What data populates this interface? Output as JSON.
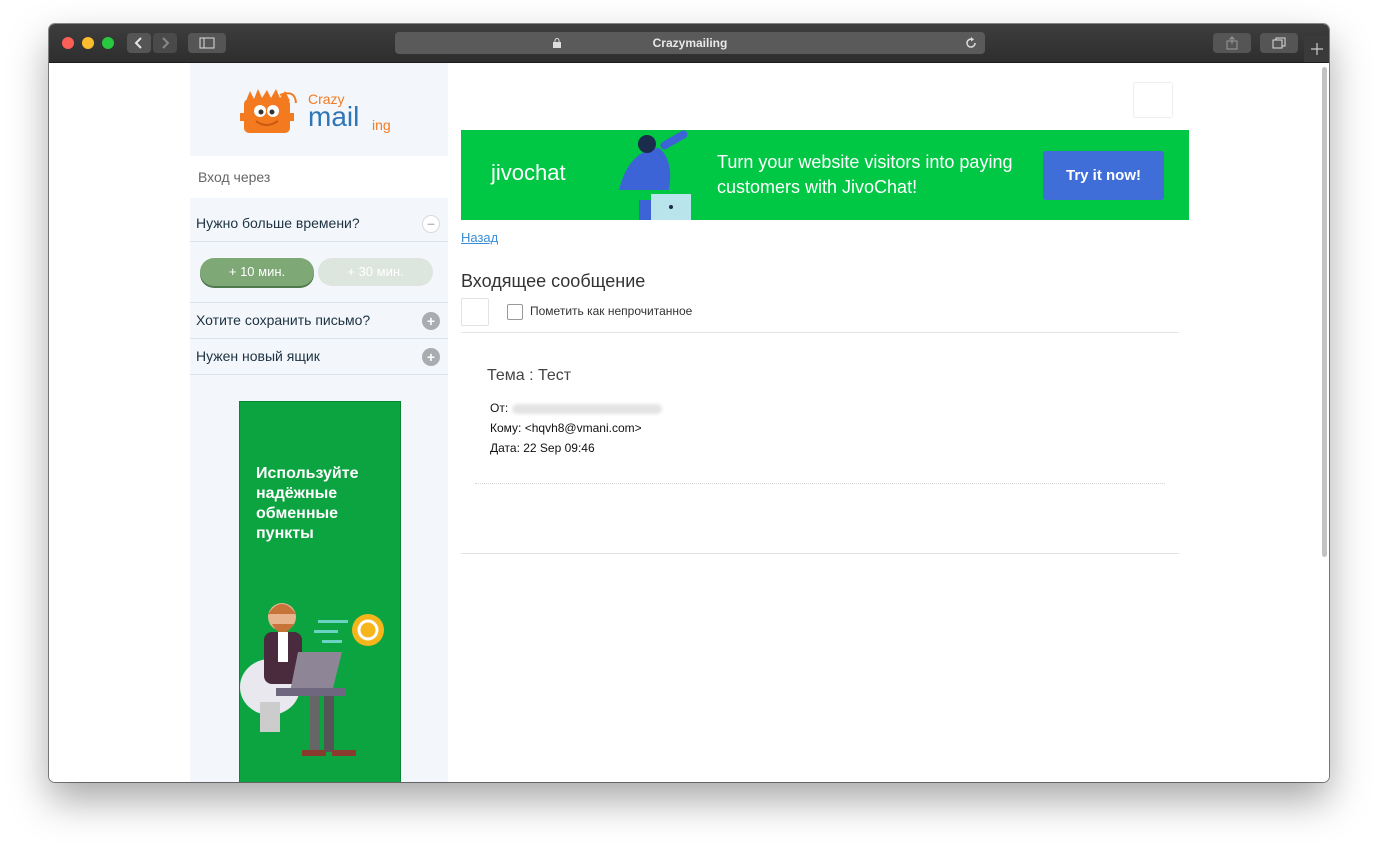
{
  "window": {
    "title": "Crazymailing"
  },
  "toolbar": {
    "back_icon": "chevron-left-icon",
    "forward_icon": "chevron-right-icon",
    "sidebar_icon": "sidebar-icon",
    "share_icon": "share-icon",
    "tabs_icon": "tabs-icon",
    "new_tab_icon": "plus-icon",
    "reload_icon": "reload-icon",
    "lock_icon": "lock-icon"
  },
  "logo": {
    "line1": "Crazy",
    "line2": "mail",
    "line3": "ing"
  },
  "sidebar": {
    "login_label": "Вход через",
    "more_time_label": "Нужно больше времени?",
    "add10_label": "+ 10 мин.",
    "add30_label": "+ 30 мин.",
    "save_letter_label": "Хотите сохранить письмо?",
    "new_box_label": "Нужен новый ящик",
    "plus_glyph": "+",
    "minus_glyph": "–"
  },
  "side_ad": {
    "text": "Используйте надёжные обменные пункты"
  },
  "banner": {
    "brand": "jivochat",
    "message": "Turn your website visitors into paying customers with JivoChat!",
    "cta": "Try it now!"
  },
  "message": {
    "back_label": "Назад",
    "header": "Входящее сообщение",
    "mark_unread_label": "Пометить как непрочитанное",
    "subject_label": "Тема : Тест",
    "from_label": "От:",
    "to_line": "Кому: <hqvh8@vmani.com>",
    "date_line": "Дата: 22 Sep 09:46"
  },
  "colors": {
    "accent_green": "#7fa877",
    "pill_disabled": "#dde5df",
    "banner_green": "#00c844",
    "cta_blue": "#3f6ed9",
    "link_blue": "#3a8dd6"
  }
}
